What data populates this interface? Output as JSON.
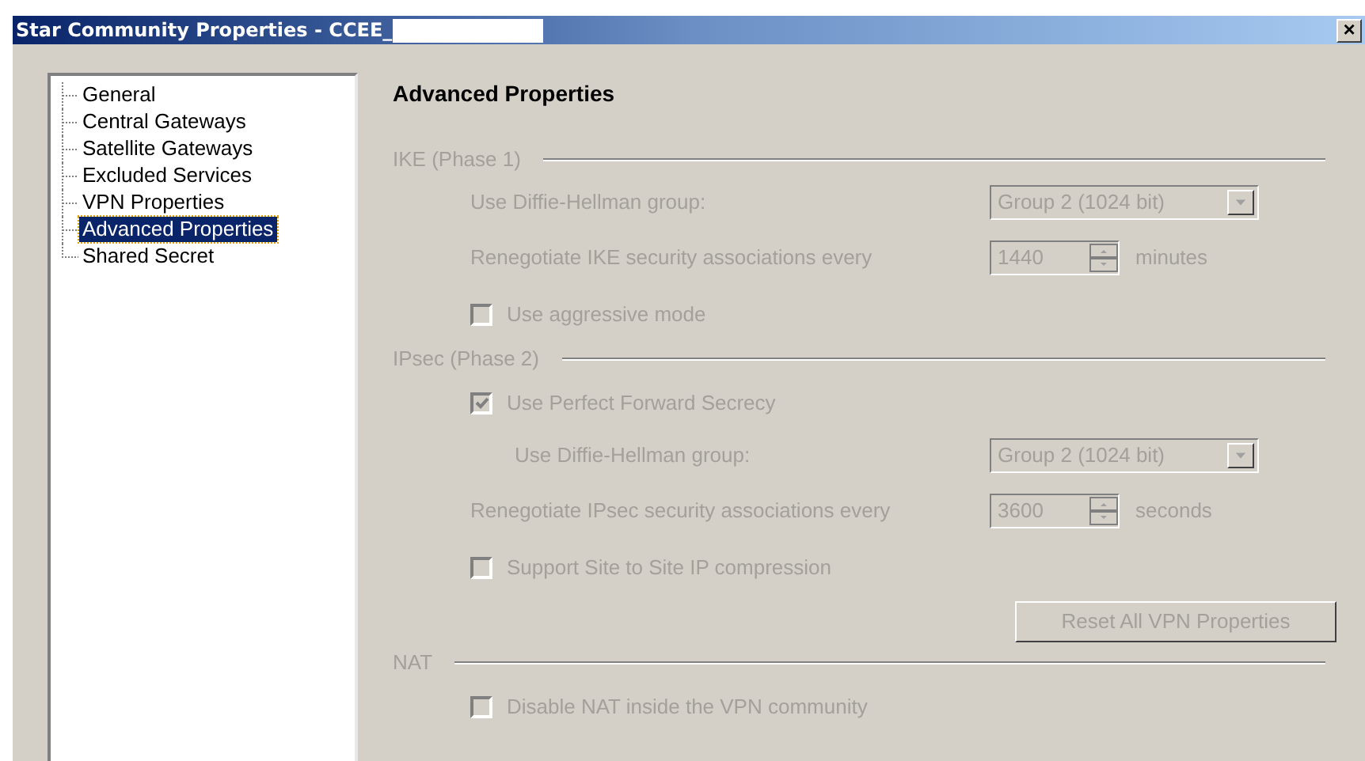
{
  "window": {
    "title": "Star Community Properties - CCEE_",
    "close": "×"
  },
  "tree": {
    "items": [
      {
        "label": "General",
        "selected": false
      },
      {
        "label": "Central Gateways",
        "selected": false
      },
      {
        "label": "Satellite Gateways",
        "selected": false
      },
      {
        "label": "Excluded Services",
        "selected": false
      },
      {
        "label": "VPN Properties",
        "selected": false
      },
      {
        "label": "Advanced Properties",
        "selected": true
      },
      {
        "label": "Shared Secret",
        "selected": false
      }
    ]
  },
  "panel": {
    "heading": "Advanced Properties",
    "sections": [
      {
        "title": "IKE (Phase 1)",
        "disabled": true,
        "rows": [
          {
            "kind": "combo",
            "label": "Use Diffie-Hellman group:",
            "value": "Group 2 (1024 bit)",
            "disabled": true
          },
          {
            "kind": "spin",
            "label": "Renegotiate IKE security associations every",
            "value": "1440",
            "unit": "minutes",
            "disabled": true
          },
          {
            "kind": "check",
            "label": "Use aggressive mode",
            "checked": false,
            "disabled": true
          }
        ]
      },
      {
        "title": "IPsec (Phase 2)",
        "disabled": true,
        "rows": [
          {
            "kind": "check",
            "label": "Use Perfect Forward Secrecy",
            "checked": true,
            "disabled": true,
            "children": [
              {
                "kind": "combo",
                "label": "Use Diffie-Hellman group:",
                "value": "Group 2 (1024 bit)",
                "disabled": true
              }
            ]
          },
          {
            "kind": "spin",
            "label": "Renegotiate IPsec security associations every",
            "value": "3600",
            "unit": "seconds",
            "disabled": true
          },
          {
            "kind": "check",
            "label": "Support Site to Site IP compression",
            "checked": false,
            "disabled": true
          },
          {
            "kind": "button",
            "label": "Reset All VPN Properties",
            "disabled": true
          }
        ]
      },
      {
        "title": "NAT",
        "disabled": true,
        "rows": [
          {
            "kind": "check",
            "label": "Disable NAT inside the VPN community",
            "checked": false,
            "disabled": true
          }
        ]
      }
    ]
  }
}
